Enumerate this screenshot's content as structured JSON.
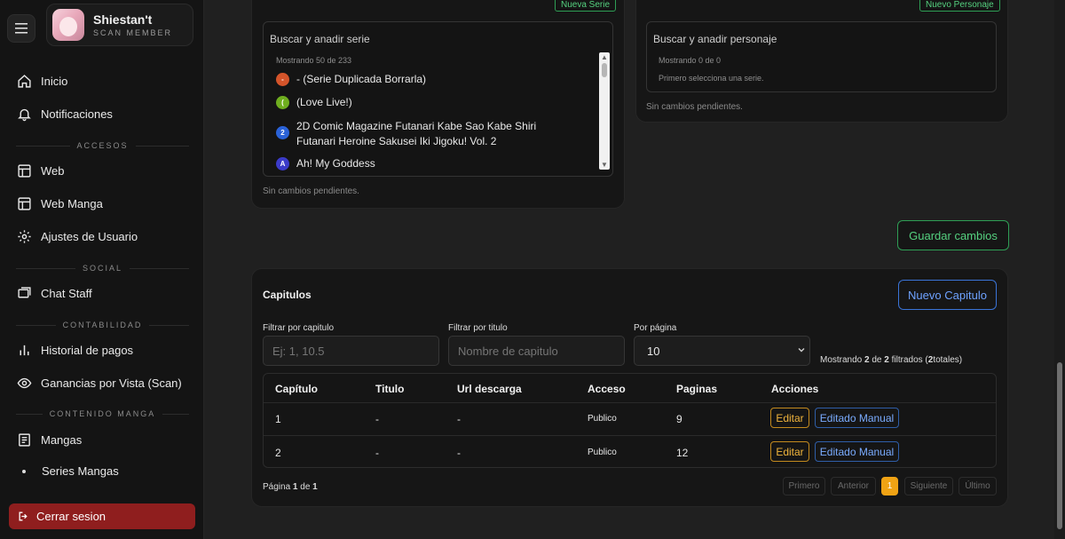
{
  "sidebar": {
    "brand_name": "Shiestan't",
    "brand_sub": "SCAN MEMBER",
    "items": [
      {
        "label": "Inicio",
        "icon": "home-icon"
      },
      {
        "label": "Notificaciones",
        "icon": "bell-icon"
      },
      {
        "label": "Web",
        "icon": "layout-icon"
      },
      {
        "label": "Web Manga",
        "icon": "layout-icon"
      },
      {
        "label": "Ajustes de Usuario",
        "icon": "gear-icon"
      },
      {
        "label": "Chat Staff",
        "icon": "chat-icon"
      },
      {
        "label": "Historial de pagos",
        "icon": "bar-chart-icon"
      },
      {
        "label": "Ganancias por Vista (Scan)",
        "icon": "eye-icon"
      },
      {
        "label": "Mangas",
        "icon": "book-icon"
      },
      {
        "label": "Series Mangas",
        "icon": "dot-icon"
      }
    ],
    "sections": [
      "ACCESOS",
      "SOCIAL",
      "CONTABILIDAD",
      "CONTENIDO MANGA"
    ],
    "logout_label": "Cerrar sesion"
  },
  "series_panel": {
    "new_button": "Nueva Serie",
    "search_title": "Buscar y anadir serie",
    "showing": "Mostrando 50 de 233",
    "items": [
      {
        "badge": "-",
        "color": "#d4542a",
        "label": "- (Serie Duplicada Borrarla)"
      },
      {
        "badge": "(",
        "color": "#6fae1f",
        "label": "(Love Live!)"
      },
      {
        "badge": "2",
        "color": "#2a62d8",
        "label": "2D Comic Magazine Futanari Kabe Sao Kabe Shiri Futanari Heroine Sakusei Iki Jigoku! Vol. 2"
      },
      {
        "badge": "A",
        "color": "#3b3bc9",
        "label": "Ah! My Goddess"
      }
    ],
    "pending": "Sin cambios pendientes."
  },
  "character_panel": {
    "new_button": "Nuevo Personaje",
    "search_title": "Buscar y anadir personaje",
    "showing": "Mostrando 0 de 0",
    "hint": "Primero selecciona una serie.",
    "pending": "Sin cambios pendientes."
  },
  "save_button": "Guardar cambios",
  "chapters": {
    "title": "Capitulos",
    "new_button": "Nuevo Capitulo",
    "filter_chapter_label": "Filtrar por capitulo",
    "filter_chapter_placeholder": "Ej: 1, 10.5",
    "filter_title_label": "Filtrar por titulo",
    "filter_title_placeholder": "Nombre de capitulo",
    "per_page_label": "Por página",
    "per_page_value": "10",
    "summary_prefix": "Mostrando ",
    "summary_shown": "2",
    "summary_mid": " de ",
    "summary_filtered": "2",
    "summary_filtered_label": " filtrados (",
    "summary_total": "2",
    "summary_suffix": "totales)",
    "columns": [
      "Capítulo",
      "Titulo",
      "Url descarga",
      "Acceso",
      "Paginas",
      "Acciones"
    ],
    "rows": [
      {
        "chapter": "1",
        "title": "-",
        "url": "-",
        "access": "Publico",
        "pages": "9"
      },
      {
        "chapter": "2",
        "title": "-",
        "url": "-",
        "access": "Publico",
        "pages": "12"
      }
    ],
    "edit_label": "Editar",
    "manual_label": "Editado Manual",
    "page_prefix": "Página ",
    "page_current": "1",
    "page_mid": " de ",
    "page_total": "1",
    "pagination": {
      "first": "Primero",
      "prev": "Anterior",
      "current": "1",
      "next": "Siguiente",
      "last": "Último"
    }
  }
}
